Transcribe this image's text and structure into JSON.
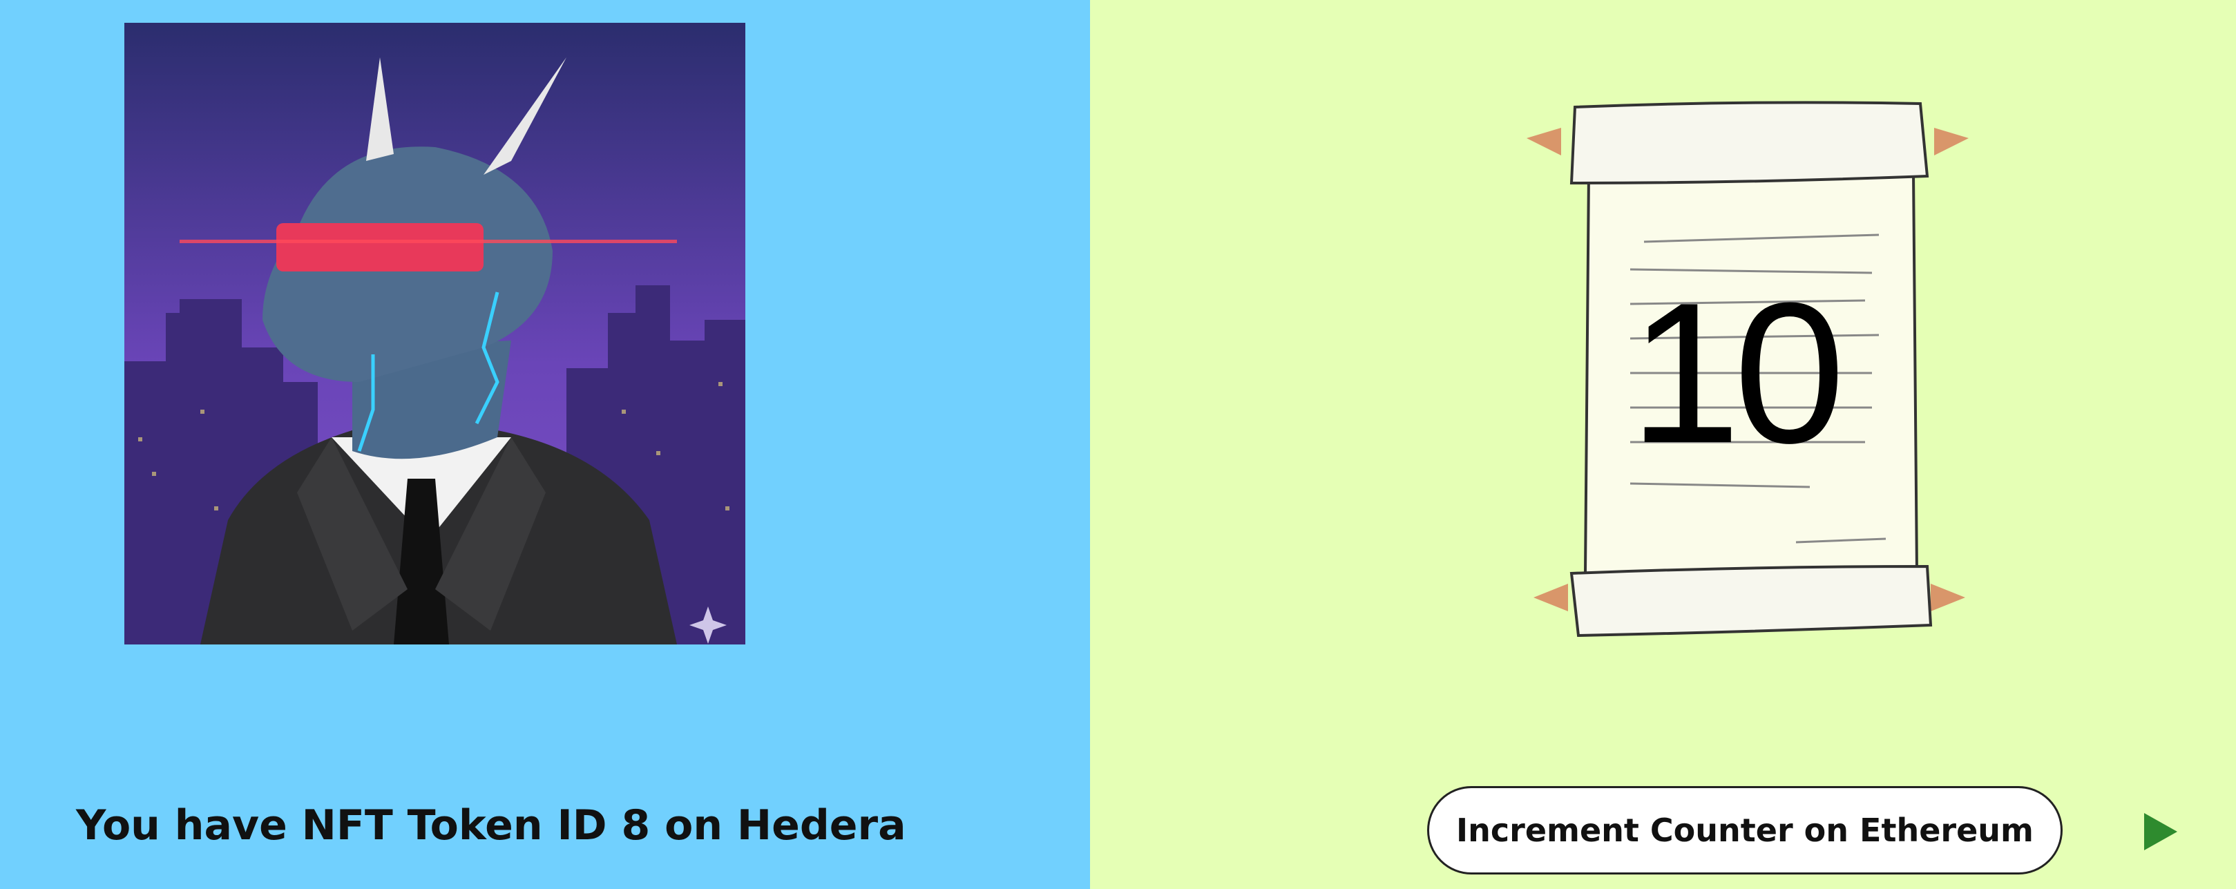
{
  "nft_panel": {
    "caption": "You have NFT Token ID 8 on Hedera",
    "image_icon": "cyber-dragon-nft-image"
  },
  "counter_panel": {
    "value": "10",
    "scroll_icon": "paper-scroll-icon",
    "button_label": "Increment Counter on Ethereum",
    "run_icon": "play-icon"
  },
  "colors": {
    "left_bg": "#71d0fe",
    "right_bg": "#e5ffb5",
    "play": "#2e8b2e"
  }
}
